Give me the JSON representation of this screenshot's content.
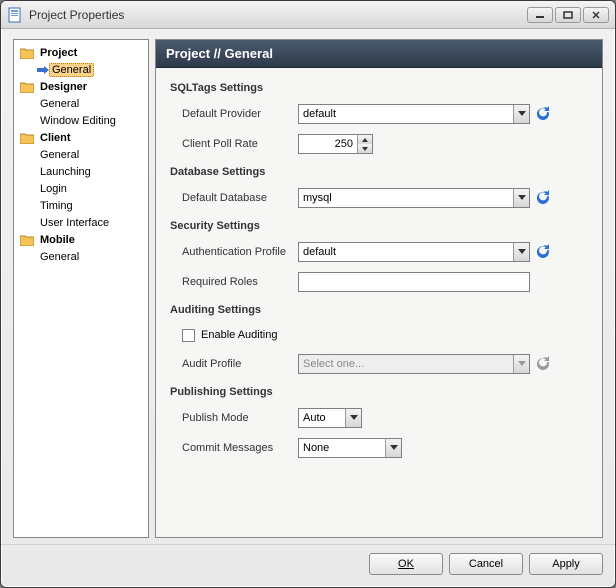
{
  "window": {
    "title": "Project Properties"
  },
  "tree": {
    "items": [
      {
        "label": "Project",
        "bold": true,
        "icon": "folder"
      },
      {
        "label": "General",
        "selected": true,
        "indent": 1,
        "arrow": true
      },
      {
        "label": "Designer",
        "bold": true,
        "icon": "folder"
      },
      {
        "label": "General",
        "indent": 1
      },
      {
        "label": "Window Editing",
        "indent": 1
      },
      {
        "label": "Client",
        "bold": true,
        "icon": "folder"
      },
      {
        "label": "General",
        "indent": 1
      },
      {
        "label": "Launching",
        "indent": 1
      },
      {
        "label": "Login",
        "indent": 1
      },
      {
        "label": "Timing",
        "indent": 1
      },
      {
        "label": "User Interface",
        "indent": 1
      },
      {
        "label": "Mobile",
        "bold": true,
        "icon": "folder"
      },
      {
        "label": "General",
        "indent": 1
      }
    ]
  },
  "main": {
    "header": "Project // General",
    "sections": {
      "sqltags": {
        "title": "SQLTags Settings",
        "default_provider_label": "Default Provider",
        "default_provider_value": "default",
        "client_poll_label": "Client Poll Rate",
        "client_poll_value": "250"
      },
      "database": {
        "title": "Database Settings",
        "default_db_label": "Default Database",
        "default_db_value": "mysql"
      },
      "security": {
        "title": "Security Settings",
        "auth_profile_label": "Authentication Profile",
        "auth_profile_value": "default",
        "required_roles_label": "Required Roles",
        "required_roles_value": ""
      },
      "auditing": {
        "title": "Auditing Settings",
        "enable_label": "Enable Auditing",
        "enable_checked": false,
        "audit_profile_label": "Audit Profile",
        "audit_profile_placeholder": "Select one..."
      },
      "publishing": {
        "title": "Publishing Settings",
        "publish_mode_label": "Publish Mode",
        "publish_mode_value": "Auto",
        "commit_label": "Commit Messages",
        "commit_value": "None"
      }
    }
  },
  "buttons": {
    "ok": "OK",
    "cancel": "Cancel",
    "apply": "Apply"
  }
}
